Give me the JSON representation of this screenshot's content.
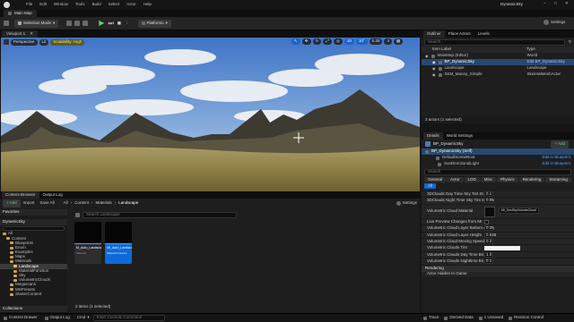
{
  "window": {
    "project": "DynamicSky"
  },
  "menu": [
    "File",
    "Edit",
    "Window",
    "Tools",
    "Build",
    "Select",
    "Actor",
    "Help"
  ],
  "tabs": {
    "map": "Main Map"
  },
  "toolbar": {
    "mode": "Selection Mode",
    "platforms": "Platforms"
  },
  "viewport": {
    "tab": "Viewport 1",
    "perspective": "Perspective",
    "lit": "Lit",
    "scalability": "Scalability: High",
    "settings": "Settings",
    "grid_snap": "10",
    "rot_snap": "10°",
    "scale_snap": "0.25",
    "cam_speed": "4"
  },
  "outliner": {
    "tabs": [
      "Outliner",
      "Place Actors",
      "Levels"
    ],
    "search_placeholder": "Search...",
    "col_label": "Item Label",
    "col_type": "Type",
    "rows": [
      {
        "label": "MainMap (Editor)",
        "type": "World",
        "sel": false,
        "indent": 0
      },
      {
        "label": "BP_DynamicSky",
        "type": "Edit BP_DynamicSky",
        "sel": true,
        "indent": 1
      },
      {
        "label": "Landscape",
        "type": "Landscape",
        "sel": false,
        "indent": 1
      },
      {
        "label": "SKM_Manny_Simple",
        "type": "SkeletalMeshActor",
        "sel": false,
        "indent": 1
      }
    ],
    "status": "3 actors (1 selected)"
  },
  "details": {
    "tabs": [
      "Details",
      "World Settings"
    ],
    "object": "BP_DynamicSky",
    "add_label": "+ Add",
    "components": [
      {
        "label": "BP_DynamicSky (Self)",
        "sel": true
      },
      {
        "label": "DefaultSceneRoot",
        "link": "Edit in Blueprint"
      },
      {
        "label": "SunDirectionalLight",
        "link": "Edit in Blueprint"
      }
    ],
    "search_placeholder": "Search",
    "filters": [
      "General",
      "Actor",
      "LOD",
      "Misc",
      "Physics",
      "Rendering",
      "Streaming",
      "All"
    ],
    "props": [
      {
        "label": "3DClouds Day Time Sky Tint St...",
        "value": "0.1"
      },
      {
        "label": "3DClouds Night Time Sky Tint St...",
        "value": "0.06"
      },
      {
        "label": "Volumetric Cloud Material",
        "value": "MI_DevSkyVolumeCloud"
      },
      {
        "label": "Live Preview Changes from MI",
        "value": ""
      },
      {
        "label": "Volumetric Cloud Layer Bottom Altit...",
        "value": "0.25"
      },
      {
        "label": "Volumetric Cloud Layer Height",
        "value": "0.625"
      },
      {
        "label": "Volumetric Cloud Moving Speed",
        "value": "0.2"
      },
      {
        "label": "Volumetric Clouds Tint",
        "value": ""
      },
      {
        "label": "Volumetric Clouds Day Time Bri...",
        "value": "1.0"
      },
      {
        "label": "Volumetric Clouds Nighttime Bri...",
        "value": "0.1"
      }
    ],
    "section_rendering": "Rendering",
    "actor_hidden": "Actor Hidden In Game"
  },
  "content_browser": {
    "tabs": [
      "Content Browser",
      "Output Log"
    ],
    "add": "+ Add",
    "import": "Import",
    "save_all": "Save All",
    "settings": "Settings",
    "path": [
      "All",
      "Content",
      "Materials",
      "Landscape"
    ],
    "search_placeholder": "Search Landscape",
    "favorites": "Favorites",
    "project": "DynamicSky",
    "folders": [
      {
        "name": "All",
        "depth": 0
      },
      {
        "name": "Content",
        "depth": 1
      },
      {
        "name": "Blueprints",
        "depth": 2
      },
      {
        "name": "Enum",
        "depth": 2
      },
      {
        "name": "Examples",
        "depth": 2
      },
      {
        "name": "Maps",
        "depth": 2
      },
      {
        "name": "Materials",
        "depth": 2
      },
      {
        "name": "Landscape",
        "depth": 3,
        "sel": true
      },
      {
        "name": "MaterialFunction",
        "depth": 3
      },
      {
        "name": "Sky",
        "depth": 3
      },
      {
        "name": "VolumetricClouds",
        "depth": 3
      },
      {
        "name": "Megascans",
        "depth": 2
      },
      {
        "name": "MSPresets",
        "depth": 2
      },
      {
        "name": "StarterContent",
        "depth": 2
      }
    ],
    "collections": "Collections",
    "assets": [
      {
        "name": "M_Auto_Landscape",
        "type": "Material",
        "sel": false
      },
      {
        "name": "MI_Auto_Landscape",
        "type": "Material Instance",
        "sel": true
      }
    ],
    "item_count": "2 items (1 selected)"
  },
  "statusbar": {
    "content_drawer": "Content Drawer",
    "output_log": "Output Log",
    "cmd": "Cmd",
    "console_placeholder": "Enter Console Command",
    "trace": "Trace",
    "derived_data": "Derived Data",
    "unsaved": "1 Unsaved",
    "revision": "Revision Control"
  },
  "colors": {
    "accent": "#0e6ad8",
    "selection": "#27486f",
    "play": "#5fd068"
  }
}
